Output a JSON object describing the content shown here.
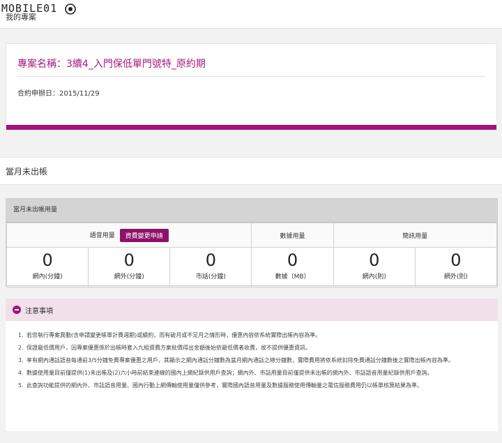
{
  "header": {
    "logo_text": "MOBILE01",
    "page_title": "我的專案"
  },
  "project": {
    "name": "專案名稱：3續4_入門保低單門號特_原約期",
    "contract_date": "合約申辦日：2015/11/29",
    "accent_color": "#a5117a"
  },
  "section": {
    "title": "當月未出帳"
  },
  "usage": {
    "heading": "當月未出帳用量",
    "voice_label": "語音用量",
    "apply_button": "資費變更申請",
    "data_label": "數據用量",
    "sms_label": "簡訊用量",
    "cells": [
      {
        "value": "0",
        "unit": "網內(分鐘)"
      },
      {
        "value": "0",
        "unit": "網外(分鐘)"
      },
      {
        "value": "0",
        "unit": "市話(分鐘)"
      },
      {
        "value": "0",
        "unit": "數據（MB）"
      },
      {
        "value": "0",
        "unit": "網內(則)"
      },
      {
        "value": "0",
        "unit": "網外(則)"
      }
    ]
  },
  "notes": {
    "title": "注意事項",
    "items": [
      {
        "idx": "1.",
        "text": "若您執行專案異動(含申請變更帳單計費週期)或續約，而有破月或不足月之情形時，優惠內容依系統實際出帳內容為準。"
      },
      {
        "idx": "2.",
        "text": "保證最低價用戶，因專案優惠係於出帳時套入九組資費方案批價得出金額後始依最低價者收費，故不提供優惠資訊。"
      },
      {
        "idx": "3.",
        "text": "享有網內通話語音每通前3/5分鐘免費專案優惠之用戶，其顯示之網內通話分鐘數為當月網內通話之總分鐘數，實際費用將依系統扣除免費通話分鐘數後之實際出帳內容為準。"
      },
      {
        "idx": "4.",
        "text": "數據使用量目前僅提供(1)未出帳及(2)六小時前結束連線的國內上網紀錄供用戶查詢；網內外、市話用量目前僅提供未出帳的網內外、市話語音用量紀錄供用戶查詢。"
      },
      {
        "idx": "5.",
        "text": "此查詢功能提供的網內外、市話語音用量、國內行動上網傳輸使用量僅供參考，實際國內語音用量及數據服務使用傳輸量之電信服務費用仍以帳單核算結果為準。"
      }
    ]
  }
}
